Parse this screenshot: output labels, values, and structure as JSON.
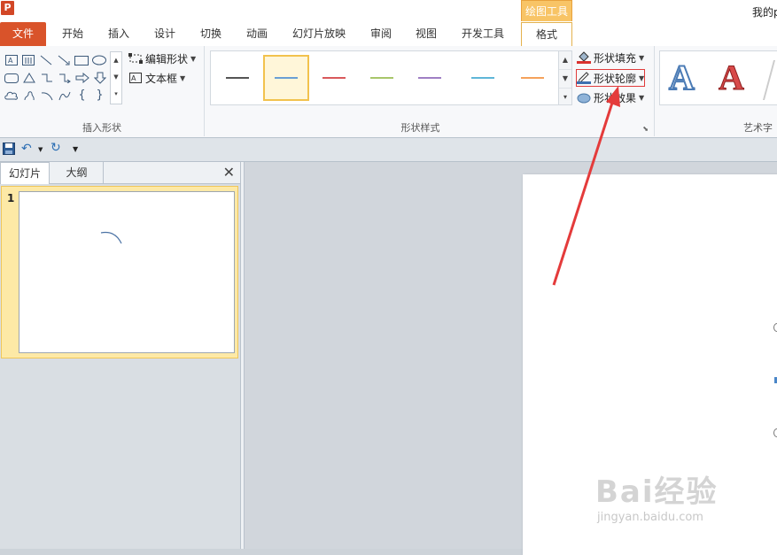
{
  "window": {
    "app_logo": "P",
    "doc_title": "我的p"
  },
  "context_tab_header": "绘图工具",
  "tabs": [
    "文件",
    "开始",
    "插入",
    "设计",
    "切换",
    "动画",
    "幻灯片放映",
    "审阅",
    "视图",
    "开发工具",
    "格式"
  ],
  "ribbon": {
    "insert_shapes": {
      "label": "插入形状",
      "edit_shape": "编辑形状",
      "text_box": "文本框"
    },
    "shape_styles": {
      "label": "形状样式",
      "swatch_colors": [
        "#555555",
        "#6a9fd4",
        "#d9595b",
        "#a8c66a",
        "#9f7fc4",
        "#5fb6d8",
        "#f5a25b"
      ],
      "fill": "形状填充",
      "outline": "形状轮廓",
      "effects": "形状效果"
    },
    "wordart": {
      "label": "艺术字",
      "glyph": "A"
    }
  },
  "left_pane": {
    "tabs": [
      "幻灯片",
      "大纲"
    ],
    "close": "✕",
    "slide_number": "1"
  },
  "watermark": {
    "brand": "Bai经验",
    "url": "jingyan.baidu.com"
  },
  "colors": {
    "file_tab": "#d9532a",
    "accent_orange": "#f8c466",
    "annotation_red": "#e03b3b"
  }
}
